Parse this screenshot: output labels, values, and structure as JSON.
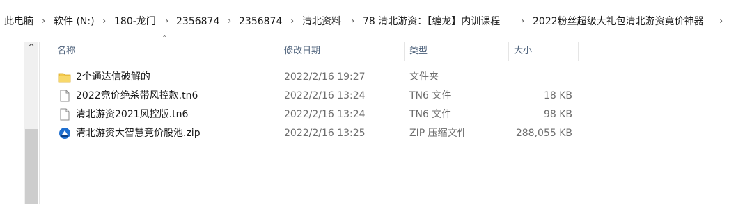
{
  "breadcrumb": [
    "此电脑",
    "软件 (N:)",
    "180-龙门",
    "2356874",
    "2356874",
    "清北资料",
    "78 清北游资：【缠龙】内训课程",
    "2022粉丝超级大礼包清北游资竟价神器"
  ],
  "columns": {
    "name": "名称",
    "date": "修改日期",
    "type": "类型",
    "size": "大小"
  },
  "files": [
    {
      "icon": "folder-icon",
      "name": "2个通达信破解的",
      "date": "2022/2/16 19:27",
      "type": "文件夹",
      "size": ""
    },
    {
      "icon": "file-icon",
      "name": "2022竞价绝杀带风控款.tn6",
      "date": "2022/2/16 13:24",
      "type": "TN6 文件",
      "size": "18 KB"
    },
    {
      "icon": "file-icon",
      "name": "清北游资2021风控版.tn6",
      "date": "2022/2/16 13:24",
      "type": "TN6 文件",
      "size": "98 KB"
    },
    {
      "icon": "zip-icon",
      "name": "清北游资大智慧竞价股池.zip",
      "date": "2022/2/16 13:25",
      "type": "ZIP 压缩文件",
      "size": "288,055 KB"
    }
  ],
  "scrollbar": {
    "up_glyph": "^"
  },
  "colors": {
    "header_text": "#4c607a",
    "folder": "#f3c84b",
    "zip": "#1e6fd0"
  }
}
